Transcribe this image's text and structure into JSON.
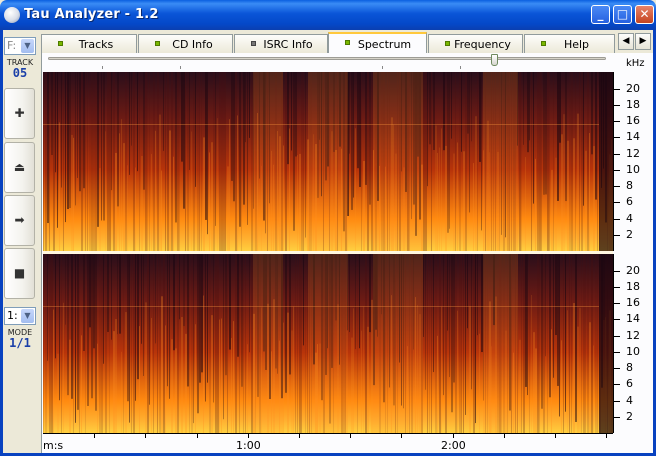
{
  "window": {
    "title": "Tau Analyzer - 1.2",
    "controls": {
      "minimize": "_",
      "maximize": "□",
      "close": "✕"
    }
  },
  "left_panel": {
    "drive_select": {
      "value": "F:"
    },
    "track_label": "TRACK",
    "track_number": "05",
    "buttons": [
      {
        "name": "add-button",
        "icon": "plus-icon",
        "glyph": "✚"
      },
      {
        "name": "eject-button",
        "icon": "eject-icon",
        "glyph": "⏏"
      },
      {
        "name": "play-button",
        "icon": "arrow-right-icon",
        "glyph": "➡"
      },
      {
        "name": "stop-button",
        "icon": "stop-icon",
        "glyph": "■"
      }
    ],
    "mode_select": {
      "value": "1:"
    },
    "mode_label": "MODE",
    "mode_value": "1/1"
  },
  "tabs": [
    {
      "label": "Tracks",
      "led": "green",
      "active": false
    },
    {
      "label": "CD Info",
      "led": "green",
      "active": false
    },
    {
      "label": "ISRC Info",
      "led": "gray",
      "active": false
    },
    {
      "label": "Spectrum",
      "led": "green",
      "active": true
    },
    {
      "label": "Frequency",
      "led": "green",
      "active": false
    },
    {
      "label": "Help",
      "led": "green",
      "active": false
    }
  ],
  "tab_nav": {
    "prev": "◀",
    "next": "▶"
  },
  "spectrum": {
    "unit_label": "kHz",
    "y_ticks_khz": [
      "20",
      "18",
      "16",
      "14",
      "12",
      "10",
      "8",
      "6",
      "4",
      "2"
    ],
    "x_axis_label": "m:s",
    "x_ticks": [
      "1:00",
      "2:00"
    ],
    "zoom_slider_fraction": 0.8,
    "channels": [
      "left",
      "right"
    ],
    "colors": {
      "dark": "#2a0e1a",
      "mid": "#b8340a",
      "bright": "#ff8a10",
      "hot": "#ffd040"
    }
  }
}
